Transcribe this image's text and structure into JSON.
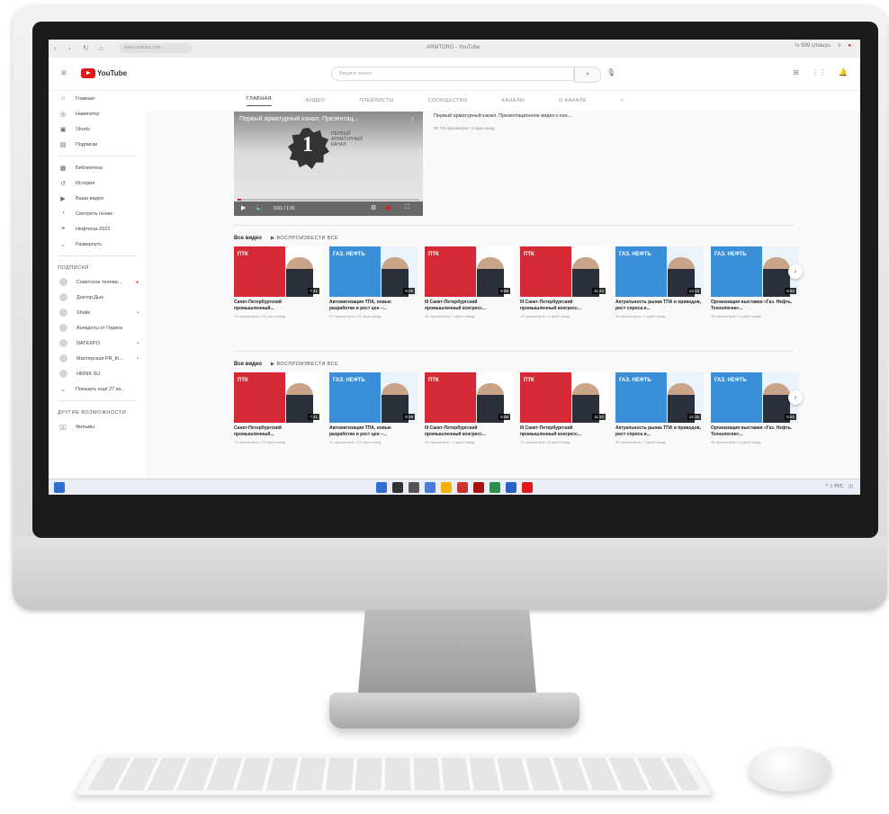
{
  "browser": {
    "url": "www.youtube.com",
    "window_title": "ARMTORG - YouTube",
    "right_info": "Is 999 cmauyu"
  },
  "header": {
    "logo_text": "YouTube",
    "search_placeholder": "Введите запрос"
  },
  "sidebar": {
    "main": [
      {
        "icon": "home-icon",
        "glyph": "⌂",
        "label": "Главная"
      },
      {
        "icon": "compass-icon",
        "glyph": "◎",
        "label": "Навигатор"
      },
      {
        "icon": "shorts-icon",
        "glyph": "▣",
        "label": "Shorts"
      },
      {
        "icon": "subscriptions-icon",
        "glyph": "▤",
        "label": "Подписки"
      }
    ],
    "library": [
      {
        "icon": "library-icon",
        "glyph": "▦",
        "label": "Библиотека"
      },
      {
        "icon": "history-icon",
        "glyph": "↺",
        "label": "История"
      },
      {
        "icon": "your-videos-icon",
        "glyph": "▶",
        "label": "Ваши видео"
      },
      {
        "icon": "watch-later-icon",
        "glyph": "◔",
        "label": "Смотреть позже"
      },
      {
        "icon": "playlist-icon",
        "glyph": "≡",
        "label": "Нефтегаз-2022"
      },
      {
        "icon": "chevron-down-icon",
        "glyph": "⌄",
        "label": "Развернуть"
      }
    ],
    "subs_header": "ПОДПИСКИ",
    "subs": [
      {
        "label": "Советское телеви...",
        "live": "●"
      },
      {
        "label": "Доктор Дью",
        "live": ""
      },
      {
        "label": "Shalie",
        "live": "•"
      },
      {
        "label": "Анекдоты от Герина",
        "live": ""
      },
      {
        "label": "NATEXPO",
        "live": "•"
      },
      {
        "label": "Мастерская PR_th...",
        "live": "•"
      },
      {
        "label": "HRINK SU",
        "live": ""
      }
    ],
    "show_more": "Показать ещё 27 ка...",
    "more_header": "ДРУГИЕ ВОЗМОЖНОСТИ",
    "films": "Фильмы"
  },
  "tabs": [
    "ГЛАВНАЯ",
    "ВИДЕО",
    "ПЛЕЙЛИСТЫ",
    "СООБЩЕСТВО",
    "КАНАЛЫ",
    "О КАНАЛЕ"
  ],
  "featured": {
    "player_title": "Первый арматурный канал. Презентац...",
    "badge_number": "1",
    "badge_text": "ПЕРВЫЙ АРМАТУРНЫЙ КАНАЛ",
    "time": "0:01 / 1:31",
    "info_title": "Первый арматурный канал. Презентационное видео к кан...",
    "info_meta": "25 744 просмотра • 3 года назад"
  },
  "shelves": [
    {
      "title": "Все видео",
      "play_all": "ВОСПРОИЗВЕСТИ ВСЕ",
      "videos": [
        {
          "title": "Санкт-Петербургский промышленный...",
          "meta": "13 просмотров • 23 часа назад",
          "duration": "7:41",
          "theme": "red"
        },
        {
          "title": "Автоматизация ТПА, новые разработки и рост цен –...",
          "meta": "27 просмотров • 23 часа назад",
          "duration": "8:29",
          "theme": "blue"
        },
        {
          "title": "III Санкт-Петербургский промышленный конгресс...",
          "meta": "16 просмотров • 1 день назад",
          "duration": "5:58",
          "theme": "red"
        },
        {
          "title": "III Санкт-Петербургский промышленный конгресс...",
          "meta": "17 просмотров • 6 дней назад",
          "duration": "11:24",
          "theme": "red"
        },
        {
          "title": "Актуальность рынка ТПА и приводов, рост спроса и...",
          "meta": "39 просмотров • 7 дней назад",
          "duration": "14:15",
          "theme": "blue"
        },
        {
          "title": "Организация выставки «Газ. Нефть. Технологии»...",
          "meta": "26 просмотров • 8 дней назад",
          "duration": "5:52",
          "theme": "blue"
        }
      ]
    },
    {
      "title": "Все видео",
      "play_all": "ВОСПРОИЗВЕСТИ ВСЕ",
      "videos": [
        {
          "title": "Санкт-Петербургский промышленный...",
          "meta": "13 просмотров • 23 часа назад",
          "duration": "7:41",
          "theme": "red"
        },
        {
          "title": "Автоматизация ТПА, новые разработки и рост цен –...",
          "meta": "27 просмотров • 23 часа назад",
          "duration": "8:29",
          "theme": "blue"
        },
        {
          "title": "III Санкт-Петербургский промышленный конгресс...",
          "meta": "16 просмотров • 1 день назад",
          "duration": "5:58",
          "theme": "red"
        },
        {
          "title": "III Санкт-Петербургский промышленный конгресс...",
          "meta": "17 просмотров • 6 дней назад",
          "duration": "11:24",
          "theme": "red"
        },
        {
          "title": "Актуальность рынка ТПА и приводов, рост спроса и...",
          "meta": "39 просмотров • 7 дней назад",
          "duration": "14:15",
          "theme": "blue"
        },
        {
          "title": "Организация выставки «Газ. Нефть. Технологии»...",
          "meta": "26 просмотров • 8 дней назад",
          "duration": "5:52",
          "theme": "blue"
        }
      ]
    }
  ],
  "thumb_label_red": "ПТК",
  "thumb_label_blue": "ГАЗ. НЕФТЬ",
  "colors": {
    "yt_red": "#e01a1a",
    "thumb_red": "#d52a35",
    "thumb_blue": "#3a8fd8"
  },
  "taskbar": {
    "apps": [
      "windows-start-icon",
      "search-icon",
      "task-view-icon",
      "chat-icon",
      "file-explorer-icon",
      "app-icon",
      "app-icon",
      "app-icon",
      "app-icon",
      "yandex-icon"
    ],
    "tray": "^ ⇩ РУС"
  }
}
